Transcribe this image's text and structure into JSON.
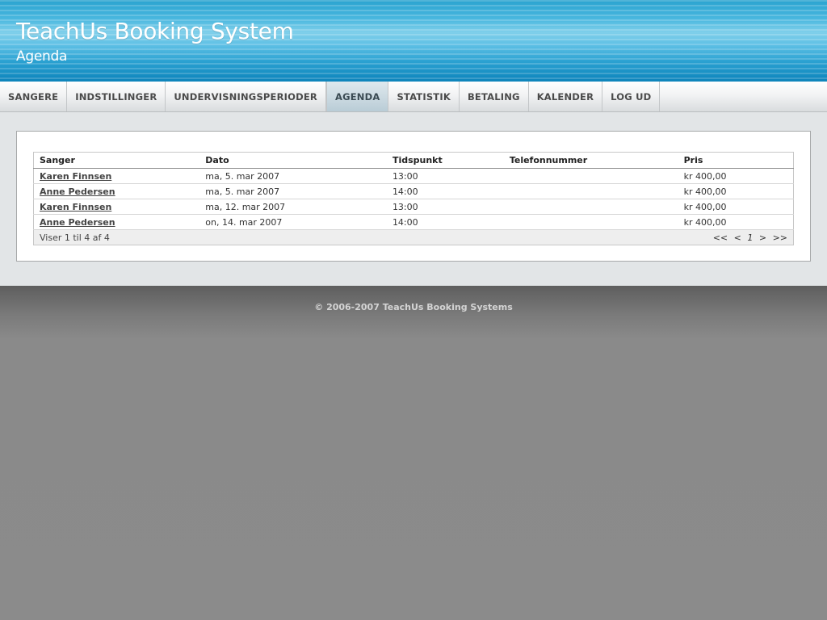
{
  "header": {
    "title": "TeachUs Booking System",
    "subtitle": "Agenda"
  },
  "nav": {
    "items": [
      {
        "label": "SANGERE"
      },
      {
        "label": "INDSTILLINGER"
      },
      {
        "label": "UNDERVISNINGSPERIODER"
      },
      {
        "label": "AGENDA",
        "active": true
      },
      {
        "label": "STATISTIK"
      },
      {
        "label": "BETALING"
      },
      {
        "label": "KALENDER"
      },
      {
        "label": "LOG UD"
      }
    ]
  },
  "table": {
    "columns": [
      "Sanger",
      "Dato",
      "Tidspunkt",
      "Telefonnummer",
      "Pris"
    ],
    "rows": [
      {
        "sanger": "Karen Finnsen",
        "dato": "ma, 5. mar 2007",
        "tidspunkt": "13:00",
        "telefon": "",
        "pris": "kr 400,00"
      },
      {
        "sanger": "Anne Pedersen",
        "dato": "ma, 5. mar 2007",
        "tidspunkt": "14:00",
        "telefon": "",
        "pris": "kr 400,00"
      },
      {
        "sanger": "Karen Finnsen",
        "dato": "ma, 12. mar 2007",
        "tidspunkt": "13:00",
        "telefon": "",
        "pris": "kr 400,00"
      },
      {
        "sanger": "Anne Pedersen",
        "dato": "on, 14. mar 2007",
        "tidspunkt": "14:00",
        "telefon": "",
        "pris": "kr 400,00"
      }
    ],
    "summary": "Viser 1 til 4 af 4",
    "pager": {
      "first": "<<",
      "prev": "<",
      "current": "1",
      "next": ">",
      "last": ">>"
    }
  },
  "footer": {
    "copyright": "© 2006-2007 TeachUs Booking Systems"
  }
}
